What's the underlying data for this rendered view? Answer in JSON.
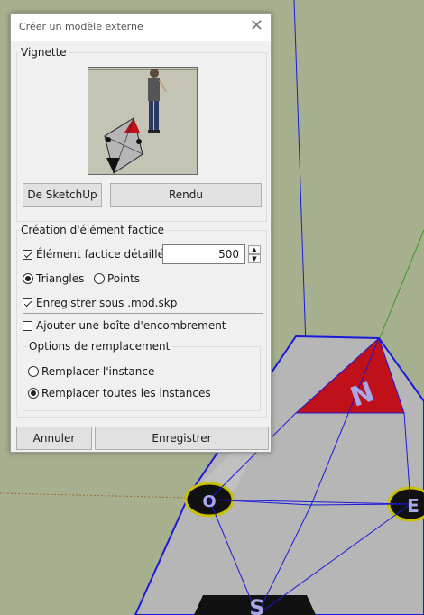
{
  "dialog": {
    "title": "Créer un modèle externe",
    "close_glyph": "✕",
    "vignette": {
      "label": "Vignette",
      "from_sketchup_button": "De SketchUp",
      "render_button": "Rendu"
    },
    "proxy": {
      "label": "Création d'élément factice",
      "detailed_label": "Élément factice détaillé",
      "detailed_checked": true,
      "count_value": "500",
      "triangles_label": "Triangles",
      "points_label": "Points",
      "triangles_selected": true,
      "save_as_label": "Enregistrer sous .mod.skp",
      "save_as_checked": true,
      "bbox_label": "Ajouter une boîte d'encombrement",
      "bbox_checked": false
    },
    "replace": {
      "label": "Options de remplacement",
      "instance_label": "Remplacer l'instance",
      "all_label": "Remplacer toutes les instances",
      "selected": "all"
    },
    "cancel_button": "Annuler",
    "save_button": "Enregistrer"
  },
  "viewport": {
    "model_letters": [
      "N",
      "E",
      "O",
      "S"
    ],
    "colors": {
      "background": "#a7b08e",
      "edges": "#1a1ad8",
      "north_triangle": "#c0101a",
      "body": "#b4b4b4",
      "yellow": "#c8c000",
      "green_axis": "#3a9a2a"
    }
  }
}
